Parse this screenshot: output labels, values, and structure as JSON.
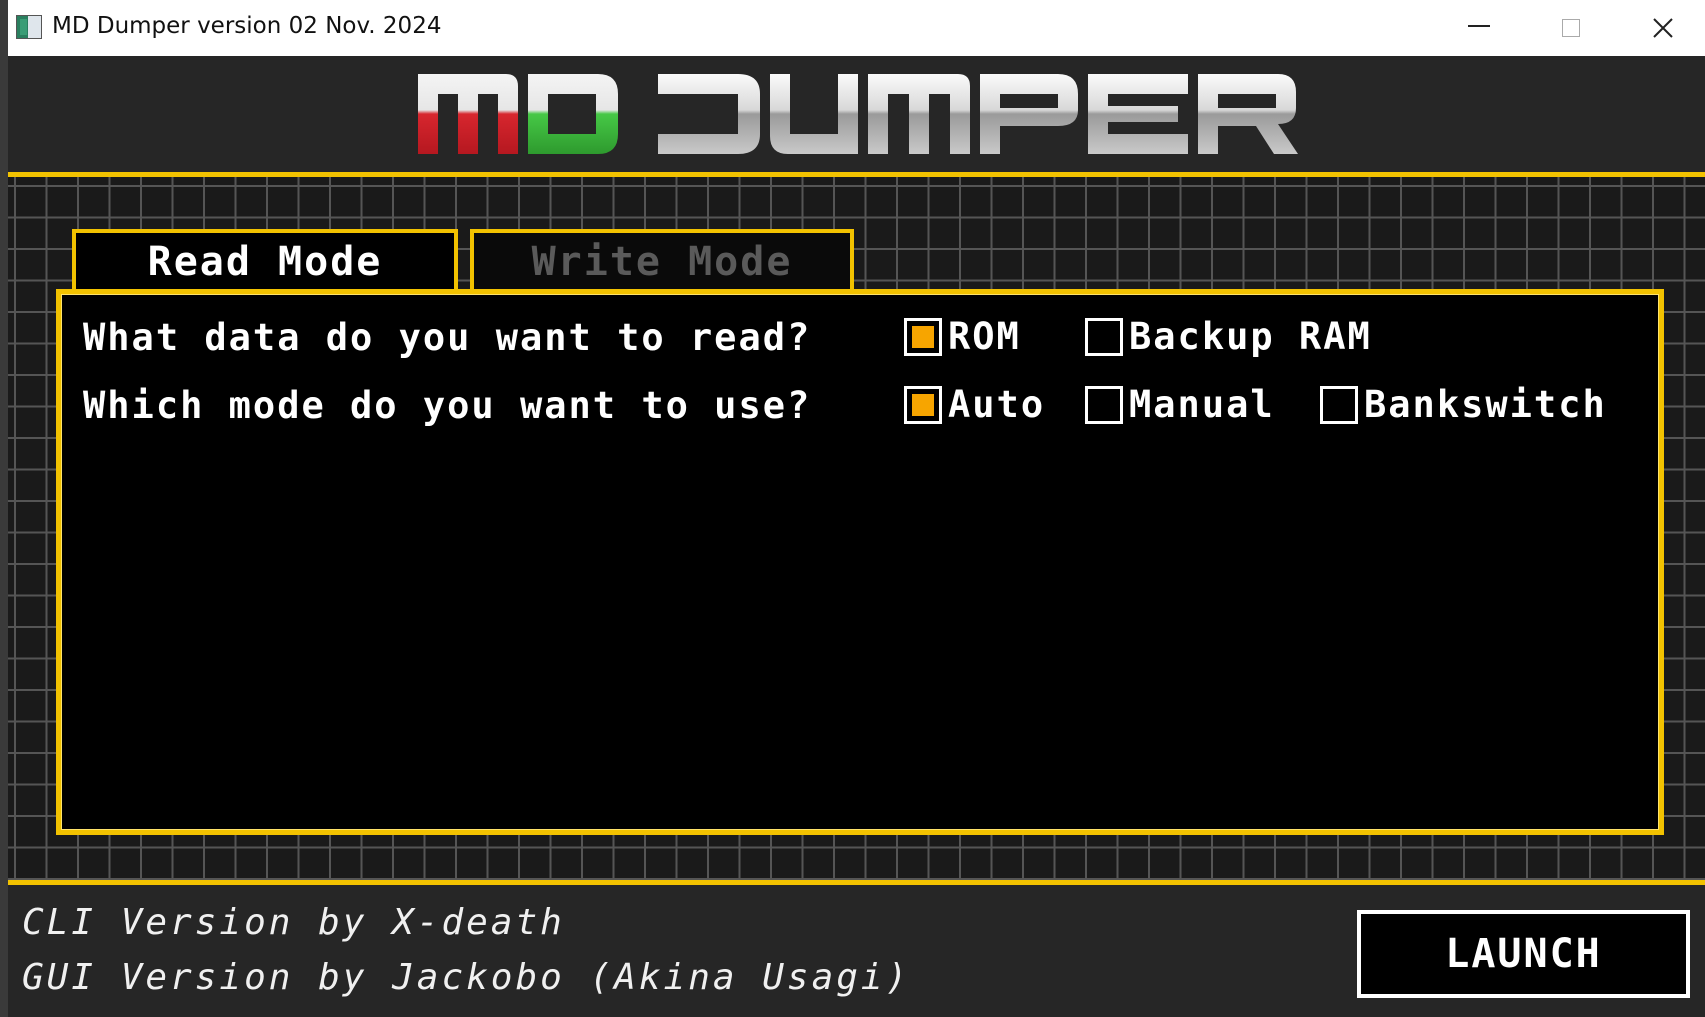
{
  "window": {
    "title": "MD Dumper version 02 Nov. 2024",
    "controls": {
      "minimize": "minimize",
      "maximize": "maximize",
      "close": "close"
    }
  },
  "header": {
    "logo_text": "MD DUMPER",
    "logo_colors": {
      "m": "#d7262e",
      "d": "#3fbf3f",
      "rest": "#cfcfcf"
    }
  },
  "tabs": [
    {
      "label": "Read Mode",
      "active": true
    },
    {
      "label": "Write Mode",
      "active": false
    }
  ],
  "read_panel": {
    "question_data": "What data do you want to read?",
    "question_mode": "Which mode do you want to use?",
    "data_options": [
      {
        "label": "ROM",
        "checked": true
      },
      {
        "label": "Backup RAM",
        "checked": false
      }
    ],
    "mode_options": [
      {
        "label": "Auto",
        "checked": true
      },
      {
        "label": "Manual",
        "checked": false
      },
      {
        "label": "Bankswitch",
        "checked": false
      }
    ]
  },
  "footer": {
    "credit_cli": "CLI Version by X-death",
    "credit_gui": "GUI Version by Jackobo (Akina Usagi)",
    "launch_label": "LAUNCH"
  },
  "colors": {
    "accent": "#f2c200",
    "checkbox_fill": "#f7a500",
    "background": "#262626",
    "panel": "#000000"
  }
}
